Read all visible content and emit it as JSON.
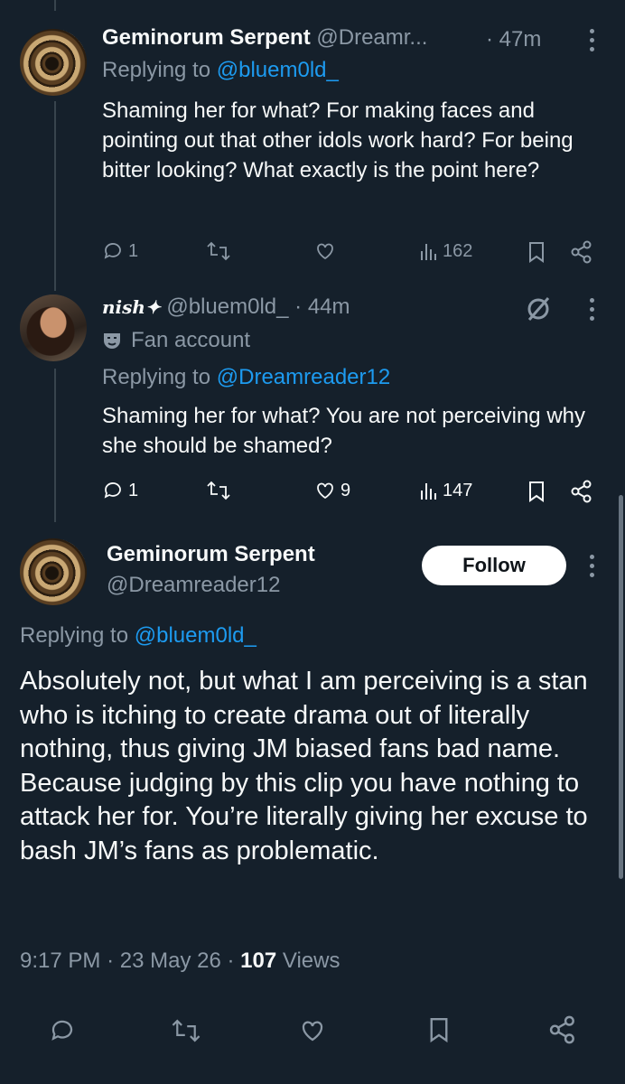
{
  "tweet1": {
    "name": "Geminorum Serpent",
    "handle": "@Dreamr...",
    "time": "· 47m",
    "replying_prefix": "Replying to",
    "replying_to": "@bluem0ld_",
    "text": "Shaming her for what? For making faces and pointing out that other idols work hard? For being bitter looking? What exactly is the point here?",
    "replies": "1",
    "retweets": "",
    "likes": "",
    "views": "162"
  },
  "tweet2": {
    "name": "nish✦",
    "handle": "@bluem0ld_",
    "time": "· 44m",
    "badge": "Fan account",
    "replying_prefix": "Replying to",
    "replying_to": "@Dreamreader12",
    "text": "Shaming her for what? You are not perceiving why she should be shamed?",
    "replies": "1",
    "retweets": "",
    "likes": "9",
    "views": "147"
  },
  "main": {
    "name": "Geminorum Serpent",
    "handle": "@Dreamreader12",
    "follow_label": "Follow",
    "replying_prefix": "Replying to",
    "replying_to": "@bluem0ld_",
    "text": "Absolutely not, but what I am perceiving is a stan who is itching to create drama out of literally nothing, thus giving JM biased fans bad name. Because judging by this clip you have nothing to attack her for. You’re literally giving her excuse to bash JM’s fans as problematic.",
    "time": "9:17 PM",
    "date": "23 May 26",
    "views_count": "107",
    "views_label": "Views"
  },
  "colors": {
    "background": "#15202b",
    "text": "#f7f9f9",
    "muted": "#8b98a5",
    "link": "#1d9bf0"
  },
  "icons": [
    "reply-icon",
    "retweet-icon",
    "like-icon",
    "views-icon",
    "bookmark-icon",
    "share-icon",
    "more-icon",
    "grok-icon",
    "fan-mask-icon"
  ]
}
